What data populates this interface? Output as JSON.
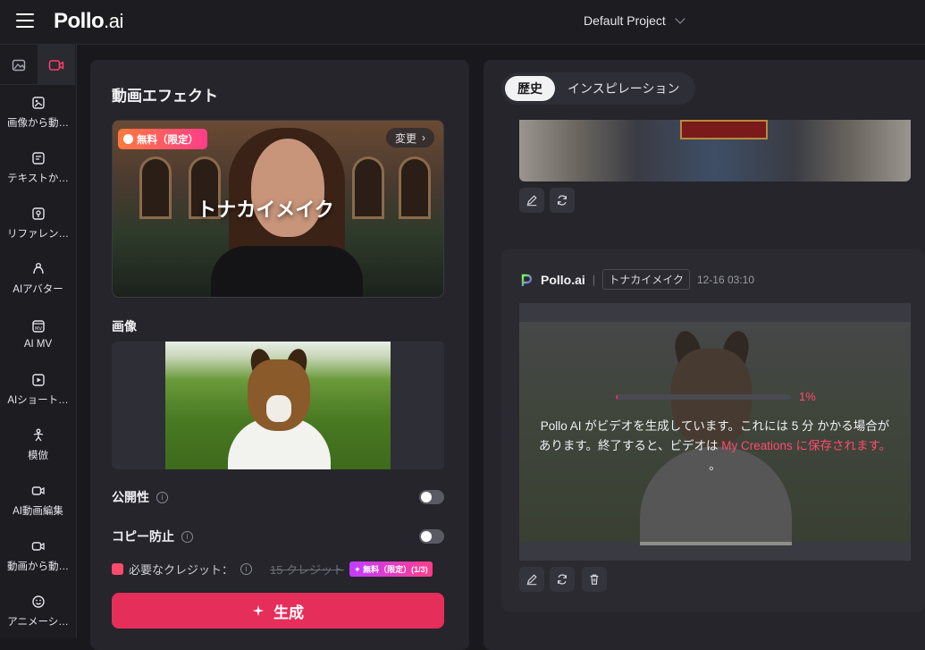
{
  "header": {
    "logo_main": "Pollo",
    "logo_suffix": ".ai",
    "project": "Default Project"
  },
  "sidebar": {
    "items": [
      {
        "label": "画像から動…",
        "icon": "image-to-video-icon"
      },
      {
        "label": "テキストか…",
        "icon": "text-to-video-icon"
      },
      {
        "label": "リファレン…",
        "icon": "reference-icon"
      },
      {
        "label": "AIアバター",
        "icon": "avatar-icon"
      },
      {
        "label": "AI MV",
        "icon": "mv-icon"
      },
      {
        "label": "AIショート…",
        "icon": "short-video-icon"
      },
      {
        "label": "模倣",
        "icon": "mimic-icon"
      },
      {
        "label": "AI動画編集",
        "icon": "video-edit-icon"
      },
      {
        "label": "動画から動…",
        "icon": "video-to-video-icon"
      },
      {
        "label": "アニメーシ…",
        "icon": "animation-icon"
      }
    ]
  },
  "left": {
    "title": "動画エフェクト",
    "effect": {
      "badge": "無料（限定）",
      "change": "変更",
      "name": "トナカイメイク"
    },
    "image_label": "画像",
    "public_label": "公開性",
    "copy_protect_label": "コピー防止",
    "credits_label": "必要なクレジット：",
    "credits_original": "15 クレジット",
    "credits_badge": "✦ 無料（限定）(1/3)",
    "generate": "生成"
  },
  "right": {
    "tabs": [
      "歴史",
      "インスピレーション"
    ],
    "card": {
      "brand": "Pollo.ai",
      "tag": "トナカイメイク",
      "time": "12-16 03:10",
      "progress_pct": 1,
      "progress_label": "1%",
      "msg_part1": "Pollo AI がビデオを生成しています。これには 5 分 かかる場合があります。終了すると、ビデオは ",
      "msg_link": "My Creations に保存されます。",
      "msg_part2": " 。"
    }
  },
  "colors": {
    "accent": "#e62e5a",
    "accent_text": "#ff4a6e"
  }
}
